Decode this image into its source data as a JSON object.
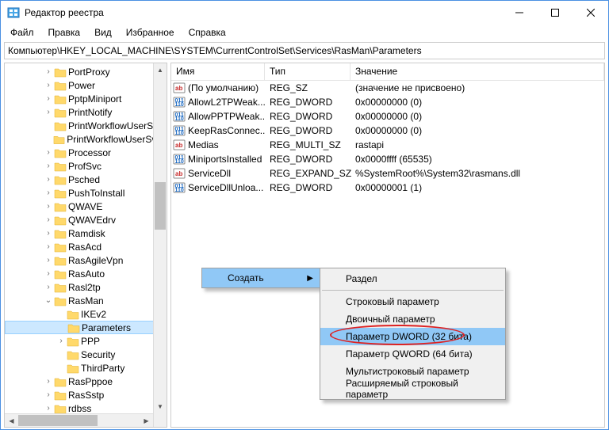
{
  "window": {
    "title": "Редактор реестра"
  },
  "menu": {
    "items": [
      "Файл",
      "Правка",
      "Вид",
      "Избранное",
      "Справка"
    ]
  },
  "path": "Компьютер\\HKEY_LOCAL_MACHINE\\SYSTEM\\CurrentControlSet\\Services\\RasMan\\Parameters",
  "tree": [
    {
      "depth": 3,
      "label": "PortProxy",
      "expander": ">"
    },
    {
      "depth": 3,
      "label": "Power",
      "expander": ">"
    },
    {
      "depth": 3,
      "label": "PptpMiniport",
      "expander": ">"
    },
    {
      "depth": 3,
      "label": "PrintNotify",
      "expander": ">"
    },
    {
      "depth": 3,
      "label": "PrintWorkflowUserSvc",
      "expander": ""
    },
    {
      "depth": 3,
      "label": "PrintWorkflowUserSvc_",
      "expander": ""
    },
    {
      "depth": 3,
      "label": "Processor",
      "expander": ">"
    },
    {
      "depth": 3,
      "label": "ProfSvc",
      "expander": ">"
    },
    {
      "depth": 3,
      "label": "Psched",
      "expander": ">"
    },
    {
      "depth": 3,
      "label": "PushToInstall",
      "expander": ">"
    },
    {
      "depth": 3,
      "label": "QWAVE",
      "expander": ">"
    },
    {
      "depth": 3,
      "label": "QWAVEdrv",
      "expander": ">"
    },
    {
      "depth": 3,
      "label": "Ramdisk",
      "expander": ">"
    },
    {
      "depth": 3,
      "label": "RasAcd",
      "expander": ">"
    },
    {
      "depth": 3,
      "label": "RasAgileVpn",
      "expander": ">"
    },
    {
      "depth": 3,
      "label": "RasAuto",
      "expander": ">"
    },
    {
      "depth": 3,
      "label": "Rasl2tp",
      "expander": ">"
    },
    {
      "depth": 3,
      "label": "RasMan",
      "expander": "v"
    },
    {
      "depth": 4,
      "label": "IKEv2",
      "expander": ""
    },
    {
      "depth": 4,
      "label": "Parameters",
      "expander": "",
      "selected": true
    },
    {
      "depth": 4,
      "label": "PPP",
      "expander": ">"
    },
    {
      "depth": 4,
      "label": "Security",
      "expander": ""
    },
    {
      "depth": 4,
      "label": "ThirdParty",
      "expander": ""
    },
    {
      "depth": 3,
      "label": "RasPppoe",
      "expander": ">"
    },
    {
      "depth": 3,
      "label": "RasSstp",
      "expander": ">"
    },
    {
      "depth": 3,
      "label": "rdbss",
      "expander": ">"
    }
  ],
  "columns": {
    "name": "Имя",
    "type": "Тип",
    "value": "Значение"
  },
  "values": [
    {
      "icon": "ab",
      "name": "(По умолчанию)",
      "type": "REG_SZ",
      "value": "(значение не присвоено)"
    },
    {
      "icon": "bin",
      "name": "AllowL2TPWeak...",
      "type": "REG_DWORD",
      "value": "0x00000000 (0)"
    },
    {
      "icon": "bin",
      "name": "AllowPPTPWeak...",
      "type": "REG_DWORD",
      "value": "0x00000000 (0)"
    },
    {
      "icon": "bin",
      "name": "KeepRasConnec...",
      "type": "REG_DWORD",
      "value": "0x00000000 (0)"
    },
    {
      "icon": "ab",
      "name": "Medias",
      "type": "REG_MULTI_SZ",
      "value": "rastapi"
    },
    {
      "icon": "bin",
      "name": "MiniportsInstalled",
      "type": "REG_DWORD",
      "value": "0x0000ffff (65535)"
    },
    {
      "icon": "ab",
      "name": "ServiceDll",
      "type": "REG_EXPAND_SZ",
      "value": "%SystemRoot%\\System32\\rasmans.dll"
    },
    {
      "icon": "bin",
      "name": "ServiceDllUnloa...",
      "type": "REG_DWORD",
      "value": "0x00000001 (1)"
    }
  ],
  "context1": {
    "create": "Создать"
  },
  "context2": {
    "section": "Раздел",
    "items": [
      "Строковый параметр",
      "Двоичный параметр",
      "Параметр DWORD (32 бита)",
      "Параметр QWORD (64 бита)",
      "Мультистроковый параметр",
      "Расширяемый строковый параметр"
    ],
    "highlight_index": 2
  }
}
